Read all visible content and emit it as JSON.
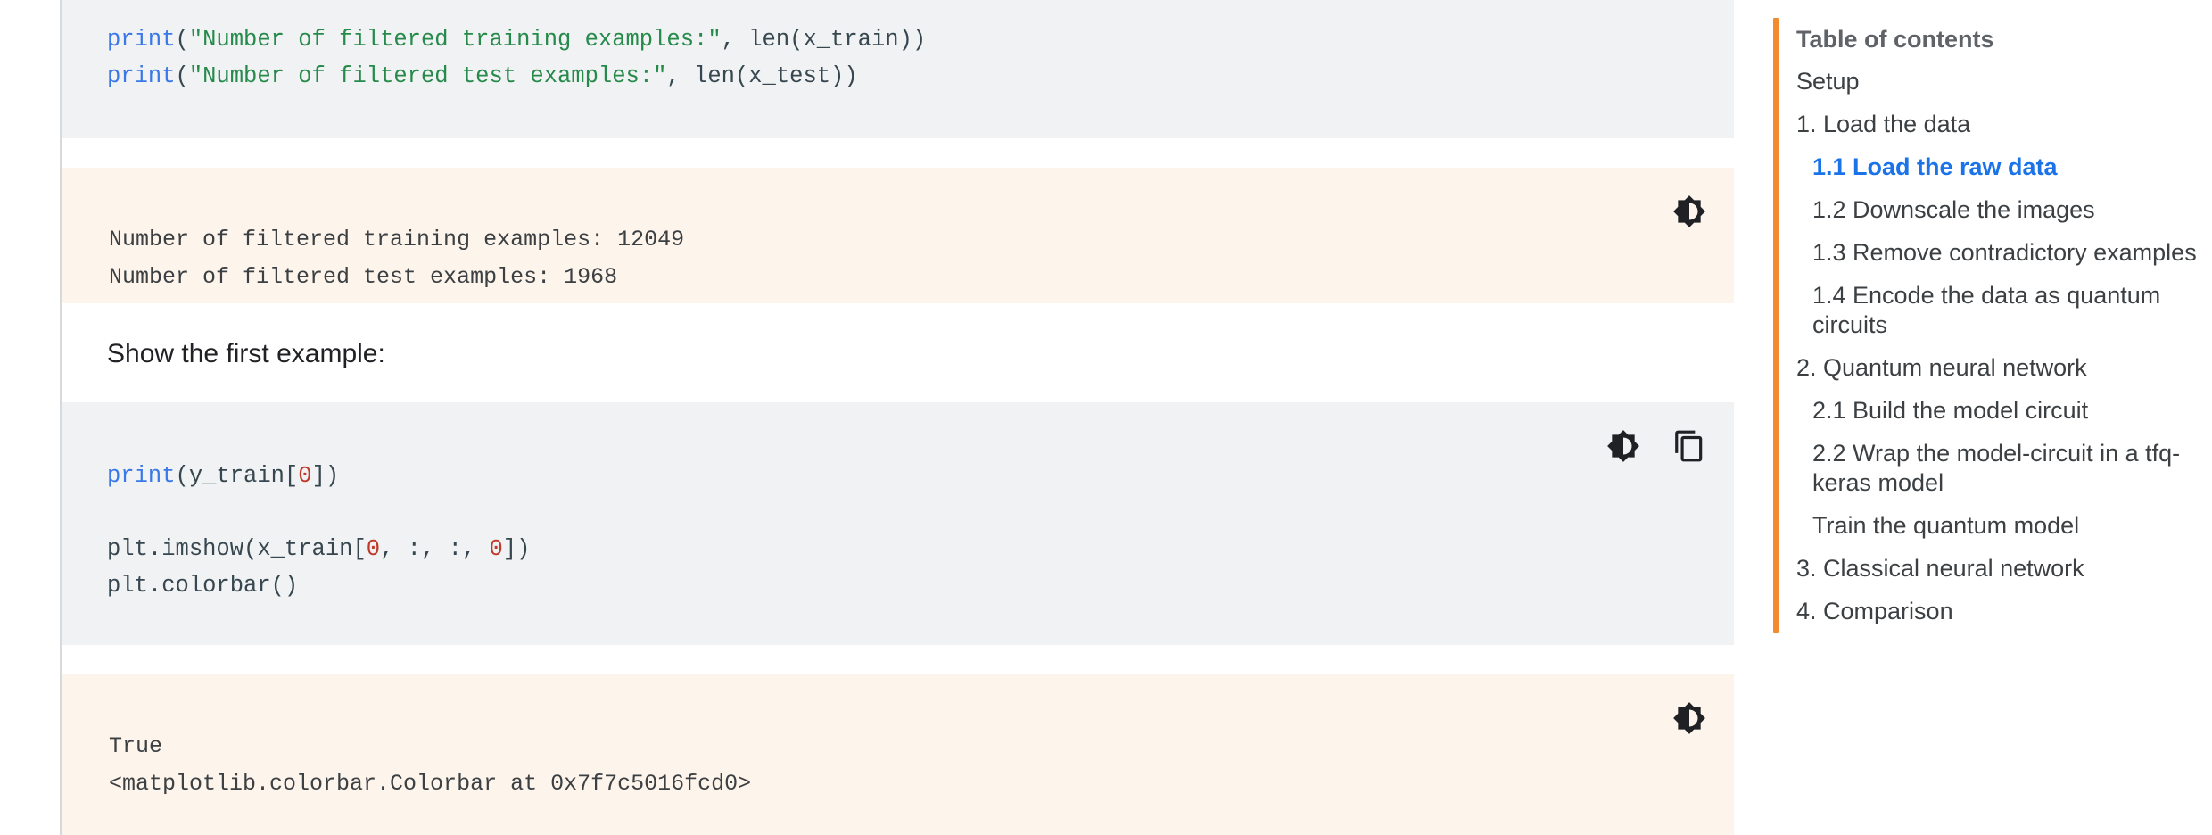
{
  "notebook": {
    "cells": [
      {
        "kind": "code",
        "name": "code-cell-print-counts",
        "lines": [
          [
            {
              "t": "print",
              "c": "fn"
            },
            {
              "t": "(",
              "c": "pln"
            },
            {
              "t": "\"Number of filtered training examples:\"",
              "c": "str"
            },
            {
              "t": ", len(x_train))",
              "c": "pln"
            }
          ],
          [
            {
              "t": "print",
              "c": "fn"
            },
            {
              "t": "(",
              "c": "pln"
            },
            {
              "t": "\"Number of filtered test examples:\"",
              "c": "str"
            },
            {
              "t": ", len(x_test))",
              "c": "pln"
            }
          ]
        ],
        "tools": []
      },
      {
        "kind": "output",
        "name": "output-cell-counts",
        "text": "Number of filtered training examples: 12049\nNumber of filtered test examples: 1968",
        "tools": [
          "brightness-icon"
        ]
      },
      {
        "kind": "markdown",
        "name": "markdown-cell-show-first-example",
        "text": "Show the first example:",
        "tools": []
      },
      {
        "kind": "code",
        "name": "code-cell-imshow",
        "lines": [
          [
            {
              "t": "print",
              "c": "fn"
            },
            {
              "t": "(y_train[",
              "c": "pln"
            },
            {
              "t": "0",
              "c": "num"
            },
            {
              "t": "])",
              "c": "pln"
            }
          ],
          [
            {
              "t": "",
              "c": "pln"
            }
          ],
          [
            {
              "t": "plt.imshow(x_train[",
              "c": "pln"
            },
            {
              "t": "0",
              "c": "num"
            },
            {
              "t": ", :, :, ",
              "c": "pln"
            },
            {
              "t": "0",
              "c": "num"
            },
            {
              "t": "])",
              "c": "pln"
            }
          ],
          [
            {
              "t": "plt.colorbar()",
              "c": "pln"
            }
          ]
        ],
        "tools": [
          "brightness-icon",
          "copy-icon"
        ]
      },
      {
        "kind": "output",
        "name": "output-cell-colorbar",
        "text": "True\n<matplotlib.colorbar.Colorbar at 0x7f7c5016fcd0>",
        "tools": [
          "brightness-icon"
        ]
      }
    ]
  },
  "toc": {
    "title": "Table of contents",
    "accent_color": "#f28b30",
    "active_color": "#1a73e8",
    "items": [
      {
        "label": "Setup",
        "level": 1,
        "active": false
      },
      {
        "label": "1. Load the data",
        "level": 1,
        "active": false
      },
      {
        "label": "1.1 Load the raw data",
        "level": 2,
        "active": true
      },
      {
        "label": "1.2 Downscale the images",
        "level": 2,
        "active": false
      },
      {
        "label": "1.3 Remove contradictory examples",
        "level": 2,
        "active": false
      },
      {
        "label": "1.4 Encode the data as quantum circuits",
        "level": 2,
        "active": false
      },
      {
        "label": "2. Quantum neural network",
        "level": 1,
        "active": false
      },
      {
        "label": "2.1 Build the model circuit",
        "level": 2,
        "active": false
      },
      {
        "label": "2.2 Wrap the model-circuit in a tfq-keras model",
        "level": 2,
        "active": false
      },
      {
        "label": "Train the quantum model",
        "level": 2,
        "active": false
      },
      {
        "label": "3. Classical neural network",
        "level": 1,
        "active": false
      },
      {
        "label": "4. Comparison",
        "level": 1,
        "active": false
      }
    ]
  },
  "colors": {
    "code_bg": "#f1f2f4",
    "output_bg": "#fdf4ec",
    "page_bg": "#ffffff",
    "gutter": "#d7dadd",
    "token_function": "#3b78e7",
    "token_string": "#258a4a",
    "token_number": "#c0392b",
    "token_plain": "#37474f"
  }
}
